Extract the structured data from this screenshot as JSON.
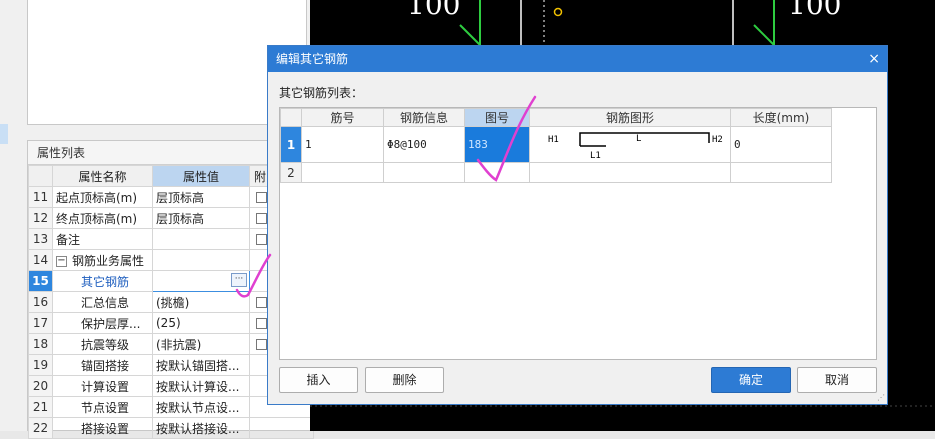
{
  "property_panel": {
    "title": "属性列表",
    "columns": [
      "属性名称",
      "属性值",
      "附"
    ],
    "rows": [
      {
        "num": "11",
        "name": "起点顶标高(m)",
        "value": "层顶标高",
        "indent": false,
        "checkbox": true
      },
      {
        "num": "12",
        "name": "终点顶标高(m)",
        "value": "层顶标高",
        "indent": false,
        "checkbox": true
      },
      {
        "num": "13",
        "name": "备注",
        "value": "",
        "indent": false,
        "checkbox": true
      },
      {
        "num": "14",
        "name": "钢筋业务属性",
        "value": "",
        "indent": false,
        "checkbox": false,
        "expand": "−"
      },
      {
        "num": "15",
        "name": "其它钢筋",
        "value": "",
        "indent": true,
        "checkbox": false,
        "current": true
      },
      {
        "num": "16",
        "name": "汇总信息",
        "value": "(挑檐)",
        "indent": true,
        "checkbox": true
      },
      {
        "num": "17",
        "name": "保护层厚...",
        "value": "(25)",
        "indent": true,
        "checkbox": true
      },
      {
        "num": "18",
        "name": "抗震等级",
        "value": "(非抗震)",
        "indent": true,
        "checkbox": true
      },
      {
        "num": "19",
        "name": "锚固搭接",
        "value": "按默认锚固搭...",
        "indent": true,
        "checkbox": false
      },
      {
        "num": "20",
        "name": "计算设置",
        "value": "按默认计算设...",
        "indent": true,
        "checkbox": false
      },
      {
        "num": "21",
        "name": "节点设置",
        "value": "按默认节点设...",
        "indent": true,
        "checkbox": false
      },
      {
        "num": "22",
        "name": "搭接设置",
        "value": "按默认搭接设...",
        "indent": true,
        "checkbox": false
      }
    ],
    "edit_button": "···"
  },
  "cad": {
    "label_left": "100",
    "label_right": "100"
  },
  "dialog": {
    "title": "编辑其它钢筋",
    "close": "×",
    "subtitle": "其它钢筋列表：",
    "columns": [
      "筋号",
      "钢筋信息",
      "图号",
      "钢筋图形",
      "长度(mm)"
    ],
    "rows": [
      {
        "num": "1",
        "bar_no": "1",
        "bar_info": "Φ8@100",
        "shape_no": "183",
        "length": "0"
      },
      {
        "num": "2",
        "bar_no": "",
        "bar_info": "",
        "shape_no": "",
        "length": ""
      }
    ],
    "shape_labels": {
      "h1": "H1",
      "l": "L",
      "h2": "H2",
      "l1": "L1"
    },
    "buttons": {
      "insert": "插入",
      "delete": "删除",
      "ok": "确定",
      "cancel": "取消"
    }
  },
  "colors": {
    "accent": "#2d7bd4",
    "selected_cell": "#1a7bdc",
    "annotation": "#e040d0",
    "cad_bg": "#000000"
  }
}
